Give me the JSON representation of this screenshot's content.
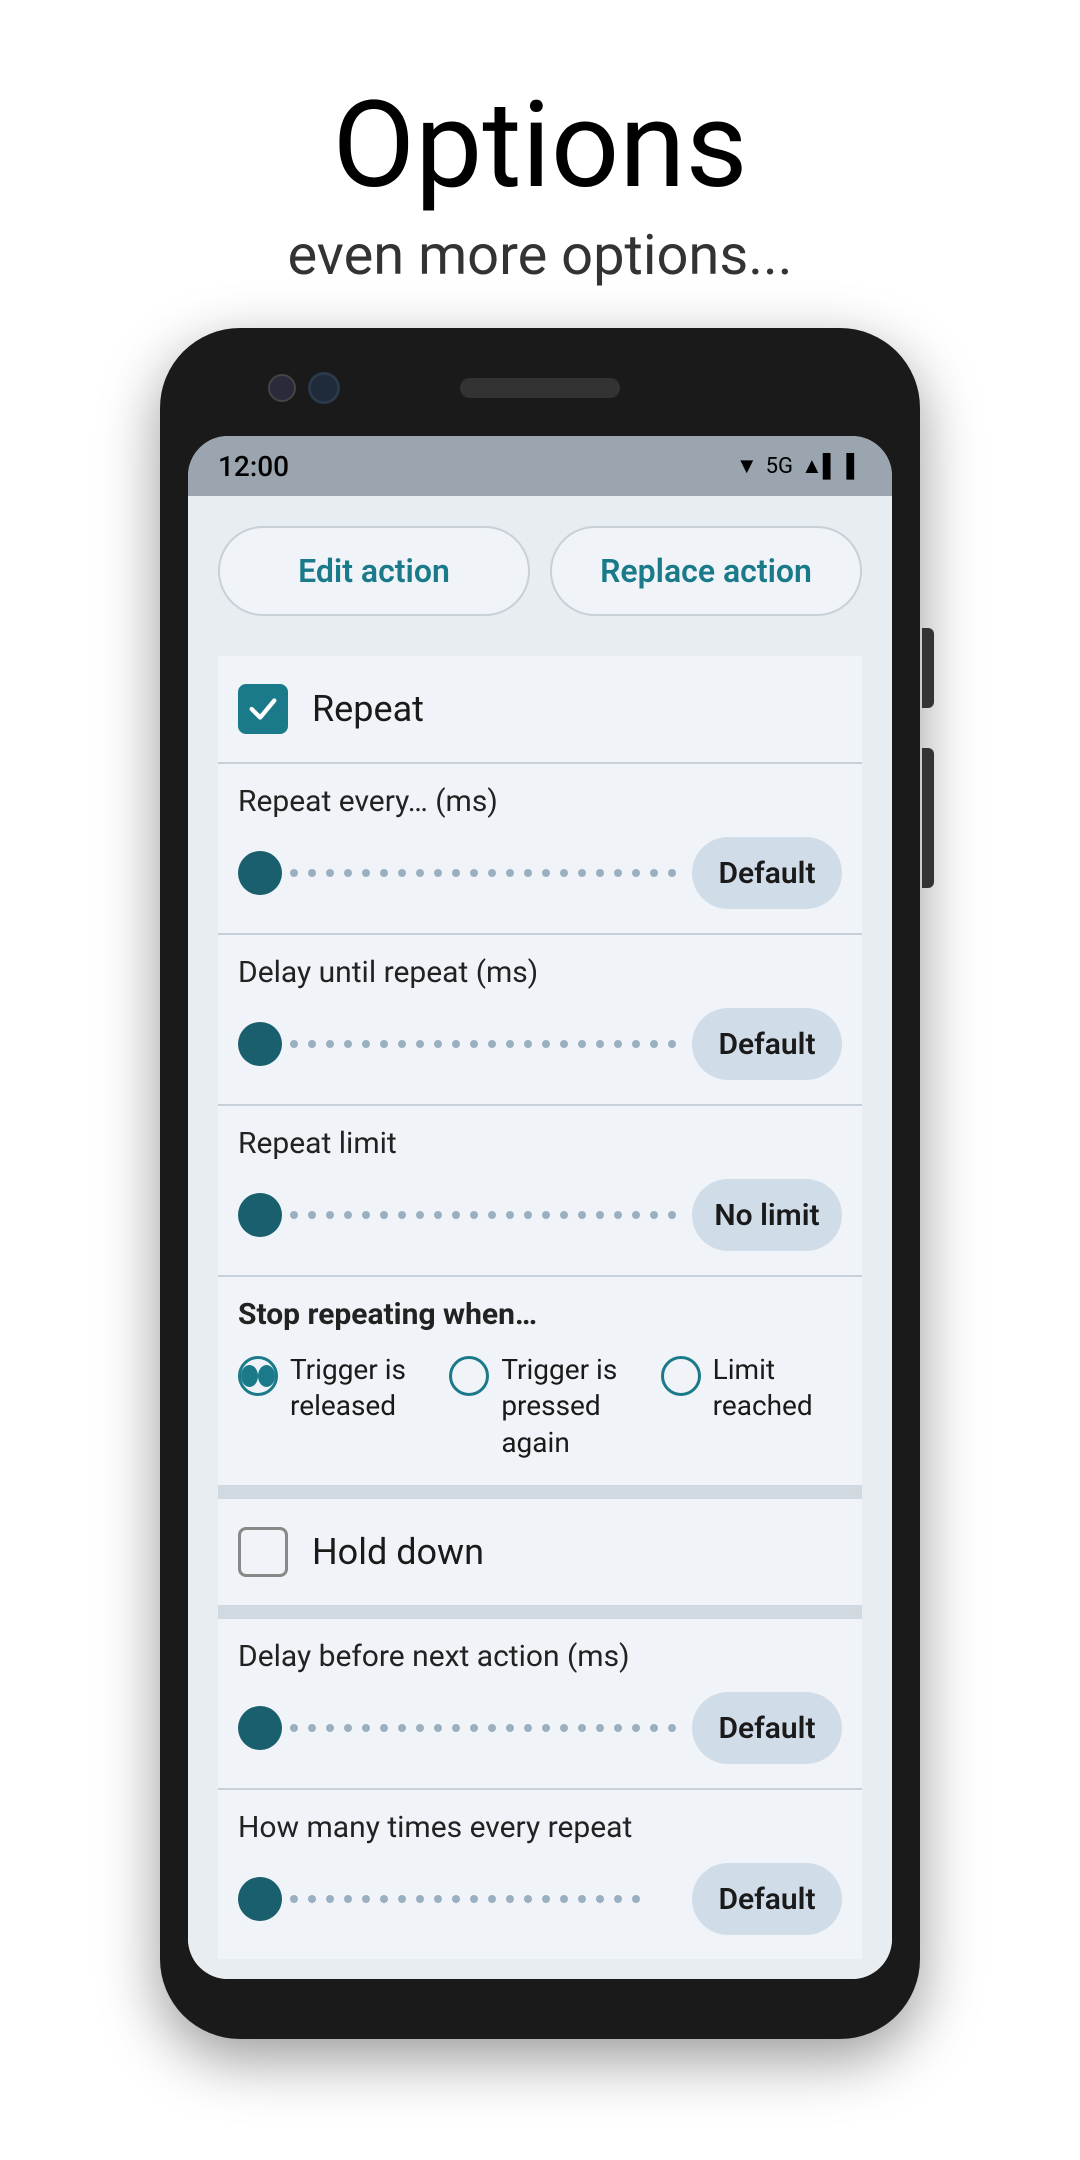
{
  "page": {
    "title": "Options",
    "subtitle": "even more options..."
  },
  "statusBar": {
    "time": "12:00",
    "network": "5G",
    "icons": "▼ 5G ▲▌▌"
  },
  "actionButtons": {
    "editAction": "Edit action",
    "replaceAction": "Replace action"
  },
  "repeatSection": {
    "checkboxLabel": "Repeat",
    "checked": true
  },
  "repeatEvery": {
    "label": "Repeat every… (ms)",
    "value": "Default"
  },
  "delayUntilRepeat": {
    "label": "Delay until repeat (ms)",
    "value": "Default"
  },
  "repeatLimit": {
    "label": "Repeat limit",
    "value": "No limit"
  },
  "stopRepeating": {
    "label": "Stop repeating when…",
    "options": [
      {
        "label": "Trigger is released",
        "selected": true
      },
      {
        "label": "Trigger is pressed again",
        "selected": false
      },
      {
        "label": "Limit reached",
        "selected": false
      }
    ]
  },
  "holdDown": {
    "checkboxLabel": "Hold down",
    "checked": false
  },
  "delayBeforeNext": {
    "label": "Delay before next action (ms)",
    "value": "Default"
  },
  "howManyTimes": {
    "label": "How many times every repeat",
    "value": "Default"
  },
  "colors": {
    "accent": "#1a7a8a",
    "sliderThumb": "#1a5f6e",
    "buttonBg": "#d0dce8",
    "screenBg": "#e8edf2",
    "sectionBg": "#f0f4f8"
  }
}
